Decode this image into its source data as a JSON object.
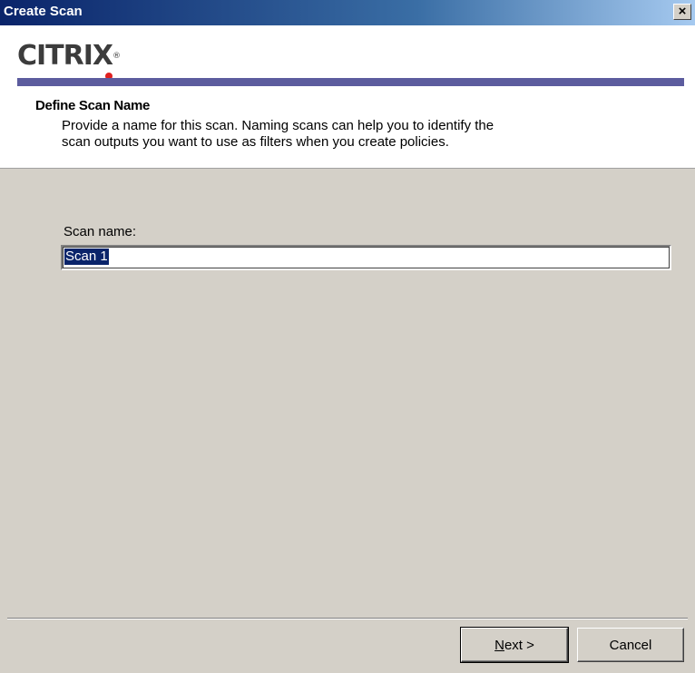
{
  "window": {
    "title": "Create Scan",
    "close_glyph": "×"
  },
  "brand": {
    "logo_text": "CITRIX",
    "trademark": "®",
    "logo_dot_color": "#e02020",
    "accent_bar_color": "#5c5c9e"
  },
  "header": {
    "section_title": "Define Scan Name",
    "description": "Provide a name for this scan. Naming scans can help you to identify the\nscan outputs you want to use as filters when you create policies."
  },
  "form": {
    "scan_name_label": "Scan name:",
    "scan_name_value": "Scan 1"
  },
  "buttons": {
    "next_label_mnemonic": "N",
    "next_label_rest": "ext >",
    "cancel_label": "Cancel"
  },
  "colors": {
    "titlebar_start": "#0a246a",
    "dialog_face": "#d4d0c8",
    "selection": "#0a246a"
  }
}
